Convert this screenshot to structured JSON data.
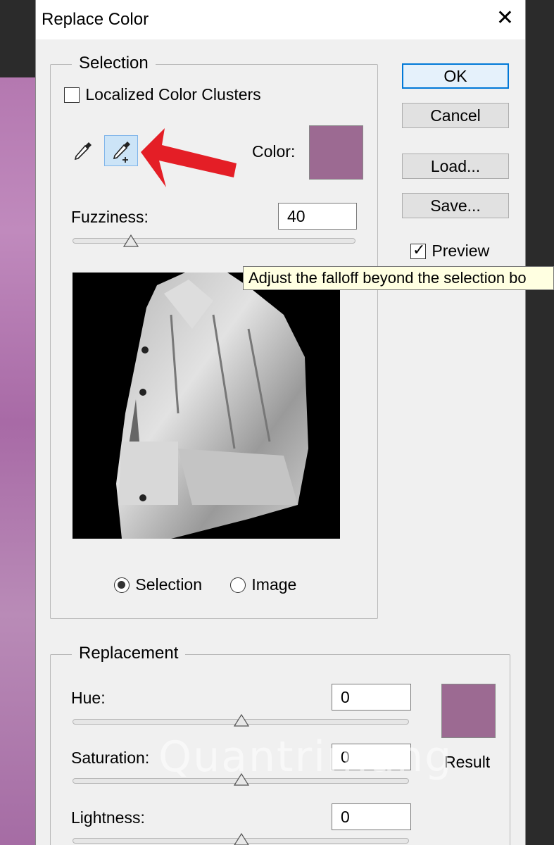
{
  "window": {
    "title": "Replace Color",
    "close_glyph": "✕"
  },
  "selection": {
    "legend": "Selection",
    "localized_label": "Localized Color Clusters",
    "localized_checked": false,
    "color_label": "Color:",
    "color_value": "#9c6a92",
    "fuzziness_label": "Fuzziness:",
    "fuzziness_value": "40",
    "view_selection_label": "Selection",
    "view_image_label": "Image",
    "view_mode": "selection",
    "eyedropper_tools": [
      "eyedropper-icon",
      "eyedropper-plus-icon"
    ]
  },
  "buttons": {
    "ok": "OK",
    "cancel": "Cancel",
    "load": "Load...",
    "save": "Save..."
  },
  "preview": {
    "label": "Preview",
    "checked": true
  },
  "tooltip": {
    "text": "Adjust the falloff beyond the selection bo"
  },
  "replacement": {
    "legend": "Replacement",
    "hue_label": "Hue:",
    "hue_value": "0",
    "saturation_label": "Saturation:",
    "saturation_value": "0",
    "lightness_label": "Lightness:",
    "lightness_value": "0",
    "result_label": "Result",
    "result_color": "#9c6a92"
  },
  "annotation": {
    "arrow_color": "#e41e26"
  },
  "watermark": {
    "text": "Quantrimang"
  }
}
